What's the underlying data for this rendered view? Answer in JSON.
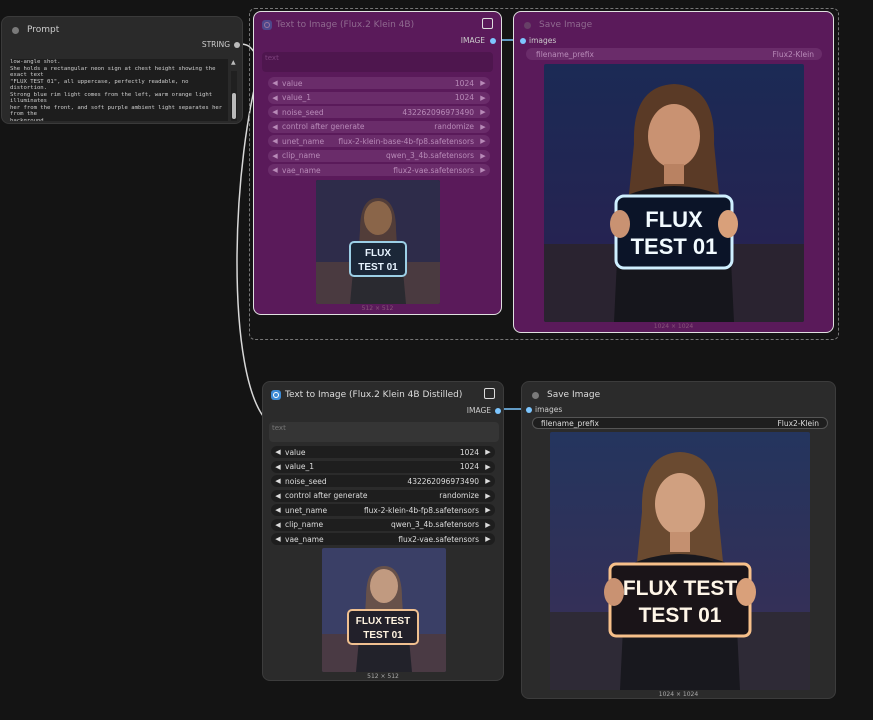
{
  "prompt_node": {
    "title": "Prompt",
    "output_label": "STRING",
    "text": "low-angle shot.\nShe holds a rectangular neon sign at chest height showing the exact text\n\"FLUX TEST 01\", all uppercase, perfectly readable, no distortion.\nStrong blue rim light comes from the left, warm orange light illuminates\nher from the front, and soft purple ambient light separates her from the\nbackground.\nThe dominant colors are deep blue, cyan, and vivid orange with strong\ncontrast.\nUltra-realistic photography, cinematic lighting, sharp focus, shallow\ndepth of field."
  },
  "t2i_base": {
    "title": "Text to Image (Flux.2 Klein 4B)",
    "output_label": "IMAGE",
    "text_placeholder": "text",
    "widgets": [
      {
        "name": "value",
        "value": "1024"
      },
      {
        "name": "value_1",
        "value": "1024"
      },
      {
        "name": "noise_seed",
        "value": "432262096973490"
      },
      {
        "name": "control after generate",
        "value": "randomize"
      },
      {
        "name": "unet_name",
        "value": "flux-2-klein-base-4b-fp8.safetensors"
      },
      {
        "name": "clip_name",
        "value": "qwen_3_4b.safetensors"
      },
      {
        "name": "vae_name",
        "value": "flux2-vae.safetensors"
      }
    ],
    "preview_caption": "512 × 512",
    "sign_line1": "FLUX",
    "sign_line2": "TEST 01"
  },
  "save_top": {
    "title": "Save Image",
    "input_label": "images",
    "prefix_name": "filename_prefix",
    "prefix_value": "Flux2-Klein",
    "caption": "1024 × 1024",
    "sign_line1": "FLUX",
    "sign_line2": "TEST 01"
  },
  "t2i_distilled": {
    "title": "Text to Image (Flux.2 Klein 4B Distilled)",
    "output_label": "IMAGE",
    "text_placeholder": "text",
    "widgets": [
      {
        "name": "value",
        "value": "1024"
      },
      {
        "name": "value_1",
        "value": "1024"
      },
      {
        "name": "noise_seed",
        "value": "432262096973490"
      },
      {
        "name": "control after generate",
        "value": "randomize"
      },
      {
        "name": "unet_name",
        "value": "flux-2-klein-4b-fp8.safetensors"
      },
      {
        "name": "clip_name",
        "value": "qwen_3_4b.safetensors"
      },
      {
        "name": "vae_name",
        "value": "flux2-vae.safetensors"
      }
    ],
    "preview_caption": "512 × 512",
    "sign_line1": "FLUX TEST",
    "sign_line2": "TEST 01"
  },
  "save_bottom": {
    "title": "Save Image",
    "input_label": "images",
    "prefix_name": "filename_prefix",
    "prefix_value": "Flux2-Klein",
    "caption": "1024 × 1024",
    "sign_line1": "FLUX TEST",
    "sign_line2": "TEST 01"
  },
  "colors": {
    "link": "#7dc6ff",
    "bypass_bg": "#5a1a5a",
    "node_bg": "#2b2b2b",
    "canvas": "#141414"
  }
}
